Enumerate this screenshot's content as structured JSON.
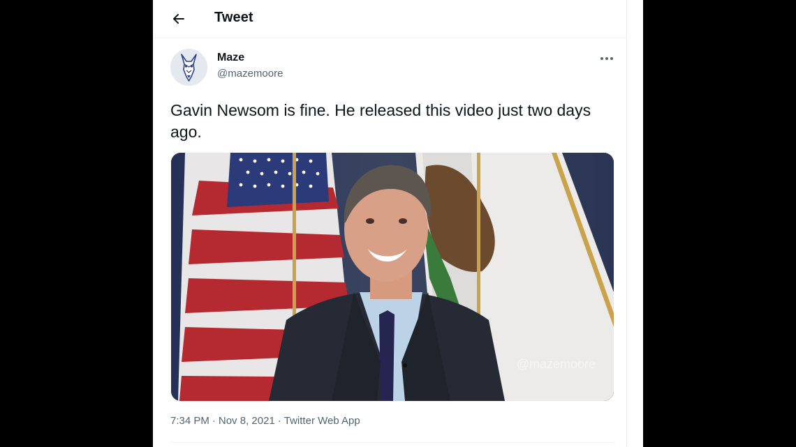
{
  "header": {
    "title": "Tweet",
    "back_icon": "arrow-left-icon"
  },
  "author": {
    "display_name": "Maze",
    "handle": "@mazemoore",
    "avatar_icon": "doberman-avatar"
  },
  "tweet": {
    "text": "Gavin Newsom is fine. He released this video just two days ago.",
    "more_icon": "more-horizontal-icon",
    "media": {
      "watermark": "@mazemoore"
    }
  },
  "meta": {
    "time": "7:34 PM",
    "separator_1": "·",
    "date": "Nov 8, 2021",
    "separator_2": "·",
    "source": "Twitter Web App"
  },
  "colors": {
    "background": "#000000",
    "panel": "#ffffff",
    "text_primary": "#0f1419",
    "text_secondary": "#536471"
  }
}
